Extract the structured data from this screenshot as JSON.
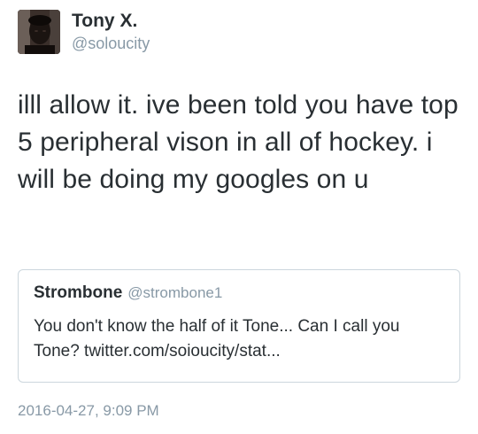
{
  "author": {
    "display_name": "Tony X.",
    "handle": "@soloucity",
    "avatar_icon": "profile-photo"
  },
  "tweet": {
    "text": "illl allow it. ive been told you have top 5 peripheral vison in all of hockey. i will be doing my googles on u",
    "timestamp": "2016-04-27, 9:09 PM"
  },
  "quoted_tweet": {
    "display_name": "Strombone",
    "handle": "@strombone1",
    "text": "You don't know the half of it Tone... Can I call you Tone? twitter.com/soioucity/stat..."
  },
  "colors": {
    "text_primary": "#292f33",
    "text_secondary": "#8899a6",
    "border": "#ccd6dd",
    "background": "#ffffff"
  }
}
